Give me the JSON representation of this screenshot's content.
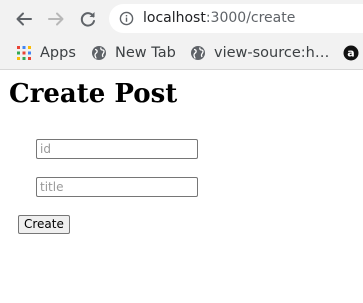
{
  "browser": {
    "address_host": "localhost",
    "address_path": ":3000/create",
    "icons": {
      "back": "back-arrow-icon",
      "forward": "forward-arrow-icon",
      "reload": "reload-icon",
      "site_info": "info-icon"
    }
  },
  "bookmarks": [
    {
      "label": "Apps",
      "icon": "apps-grid-icon"
    },
    {
      "label": "New Tab",
      "icon": "globe-icon"
    },
    {
      "label": "view-source:h…",
      "icon": "globe-icon"
    },
    {
      "label": "a",
      "icon": "amazon-icon"
    }
  ],
  "page": {
    "title": "Create Post",
    "form": {
      "id_field": {
        "placeholder": "id",
        "value": ""
      },
      "title_field": {
        "placeholder": "title",
        "value": ""
      },
      "submit_label": "Create"
    }
  },
  "colors": {
    "chrome_bg": "#f2f2f2",
    "omnibox_bg": "#ffffff",
    "icon_gray": "#5f6368",
    "icon_disabled": "#b8b8b8"
  }
}
